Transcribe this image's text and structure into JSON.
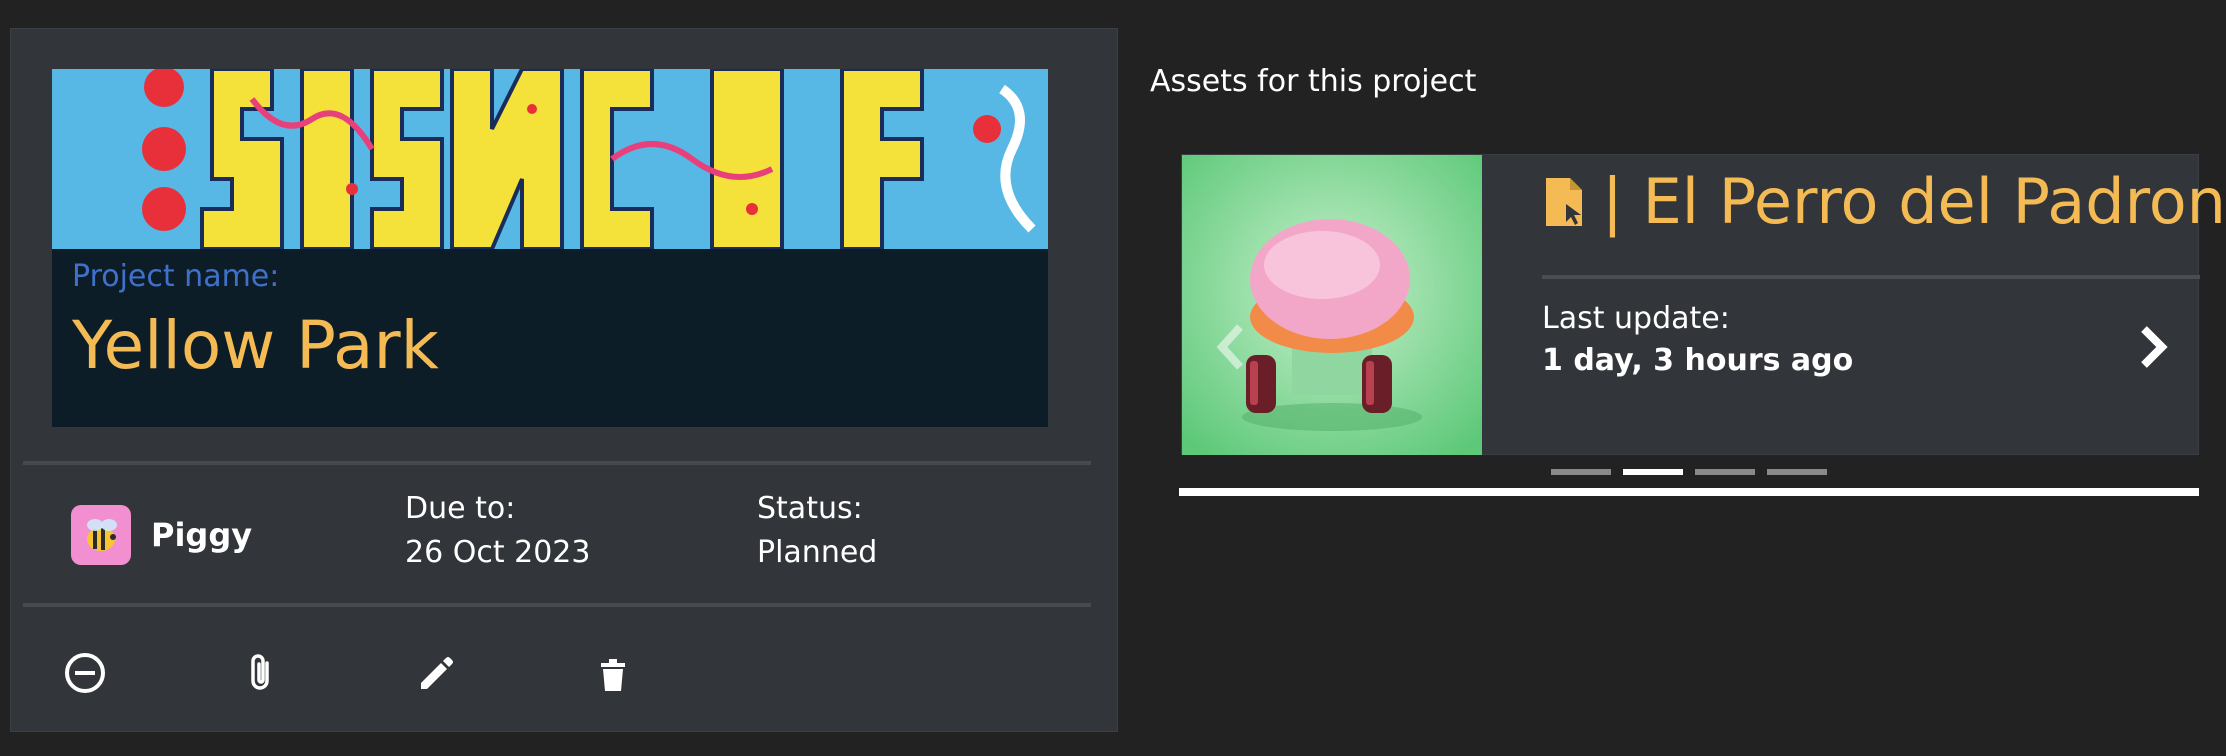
{
  "project": {
    "name_label": "Project name:",
    "name": "Yellow Park",
    "owner": {
      "name": "Piggy",
      "avatar_icon": "bee-icon"
    },
    "due_label": "Due to:",
    "due_value": "26 Oct 2023",
    "status_label": "Status:",
    "status_value": "Planned",
    "actions": [
      {
        "icon": "minus-circle-icon"
      },
      {
        "icon": "paperclip-icon"
      },
      {
        "icon": "pencil-icon"
      },
      {
        "icon": "trash-icon"
      }
    ]
  },
  "assets": {
    "section_title": "Assets for this project",
    "current": {
      "title": "| El Perro del Padron",
      "icon": "file-cursor-icon",
      "update_label": "Last update:",
      "update_value": "1 day, 3 hours ago"
    },
    "carousel": {
      "count": 4,
      "active_index": 1
    }
  },
  "colors": {
    "background": "#222222",
    "card": "#323539",
    "accent": "#f4bb54",
    "label_blue": "#3f71cc",
    "name_panel": "#0d1d27"
  }
}
